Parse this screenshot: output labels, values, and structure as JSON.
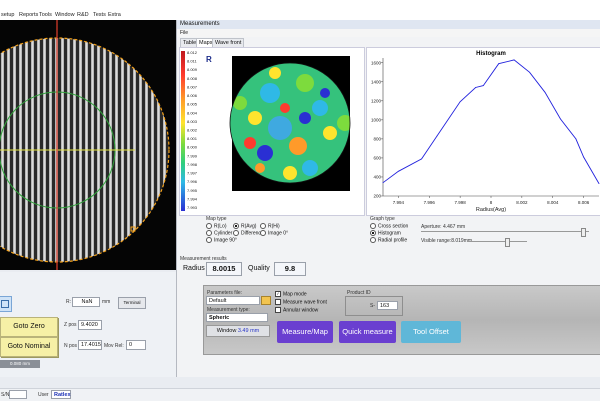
{
  "menubar": {
    "items": [
      "setup",
      "Reports",
      "Tools",
      "Window",
      "R&D",
      "Tests",
      "Extra"
    ]
  },
  "measurements": {
    "title": "Measurements",
    "menu_file": "File",
    "tabs": [
      "Table",
      "Maps",
      "Wave front"
    ],
    "colorbar_labels": [
      "8.012",
      "8.011",
      "8.009",
      "8.008",
      "8.007",
      "8.006",
      "8.005",
      "8.004",
      "8.003",
      "8.002",
      "8.001",
      "8.000",
      "7.999",
      "7.998",
      "7.997",
      "7.996",
      "7.995",
      "7.994",
      "7.993"
    ],
    "colorbar_corner": "R",
    "map_type": {
      "title": "Map type",
      "options": [
        {
          "label": "R(Lo)",
          "checked": false
        },
        {
          "label": "R(Avg)",
          "checked": true
        },
        {
          "label": "R(Hi)",
          "checked": false
        },
        {
          "label": "Cylinder",
          "checked": false
        },
        {
          "label": "Difference",
          "checked": false
        },
        {
          "label": "Image 0°",
          "checked": false
        },
        {
          "label": "Image 90°",
          "checked": false
        }
      ]
    },
    "graph_type": {
      "title": "Graph type",
      "options": [
        {
          "label": "Cross section",
          "checked": false
        },
        {
          "label": "Histogram",
          "checked": true
        },
        {
          "label": "Radial profile",
          "checked": false
        }
      ],
      "aperture": "Aperture: 4.467 mm",
      "visible_range": "Visible range:8.019mm"
    },
    "results": {
      "title": "Measurement results",
      "radius_label": "Radius",
      "radius_value": "8.0015",
      "quality_label": "Quality",
      "quality_value": "9.8"
    }
  },
  "chart_data": {
    "type": "line",
    "title": "Histogram",
    "xlabel": "Radius(Avg)",
    "ylabel": "",
    "xlim": [
      7.993,
      8.007
    ],
    "ylim": [
      200,
      1650
    ],
    "xticks": [
      7.994,
      7.996,
      7.998,
      8.0,
      8.002,
      8.004,
      8.006
    ],
    "xtick_labels": [
      "7.994",
      "7.996",
      "7.998",
      "8",
      "8.002",
      "8.004",
      "8.006"
    ],
    "yticks": [
      200,
      400,
      600,
      800,
      1000,
      1200,
      1400,
      1600
    ],
    "color": "#2222dd",
    "x": [
      7.993,
      7.994,
      7.9955,
      7.9965,
      7.998,
      7.999,
      7.9995,
      8.0005,
      8.0015,
      8.0025,
      8.0035,
      8.0045,
      8.0055,
      8.006,
      8.007
    ],
    "y": [
      340,
      460,
      590,
      830,
      1190,
      1340,
      1360,
      1590,
      1630,
      1500,
      1290,
      1010,
      800,
      610,
      330
    ]
  },
  "params": {
    "file_label": "Parameters file:",
    "file_value": "Default",
    "type_label": "Measurement type:",
    "type_value": "Spheric",
    "window_label": "Window",
    "window_value": "3.49 mm",
    "checks": [
      {
        "label": "Map mode",
        "checked": true
      },
      {
        "label": "Measure wave front",
        "checked": false
      },
      {
        "label": "Annular window",
        "checked": false
      }
    ],
    "product_id_label": "Product ID",
    "product_prefix": "S-",
    "product_value": "163",
    "btn_measure_map": "Measure/Map",
    "btn_quick": "Quick measure",
    "btn_tool_offset": "Tool Offset",
    "colors": {
      "purple": "#6a3fd0",
      "tool": "#5fb7d8"
    }
  },
  "left": {
    "r_label": "R:",
    "r_value": "NaN",
    "r_unit": "mm",
    "terminal_label": "Terminal",
    "goto_zero": "Goto Zero",
    "goto_nominal": "Goto Nominal",
    "zpos_label": "Z pos",
    "zpos_value": "9.4020",
    "npos_label": "N pos",
    "npos_value": "17.4015",
    "movrel_label": "Mov Rel:",
    "movrel_value": "0",
    "scale_label": "0.080 mm"
  },
  "status": {
    "sn_label": "S/N",
    "user_label": "User",
    "user_value": "Ratlex"
  }
}
